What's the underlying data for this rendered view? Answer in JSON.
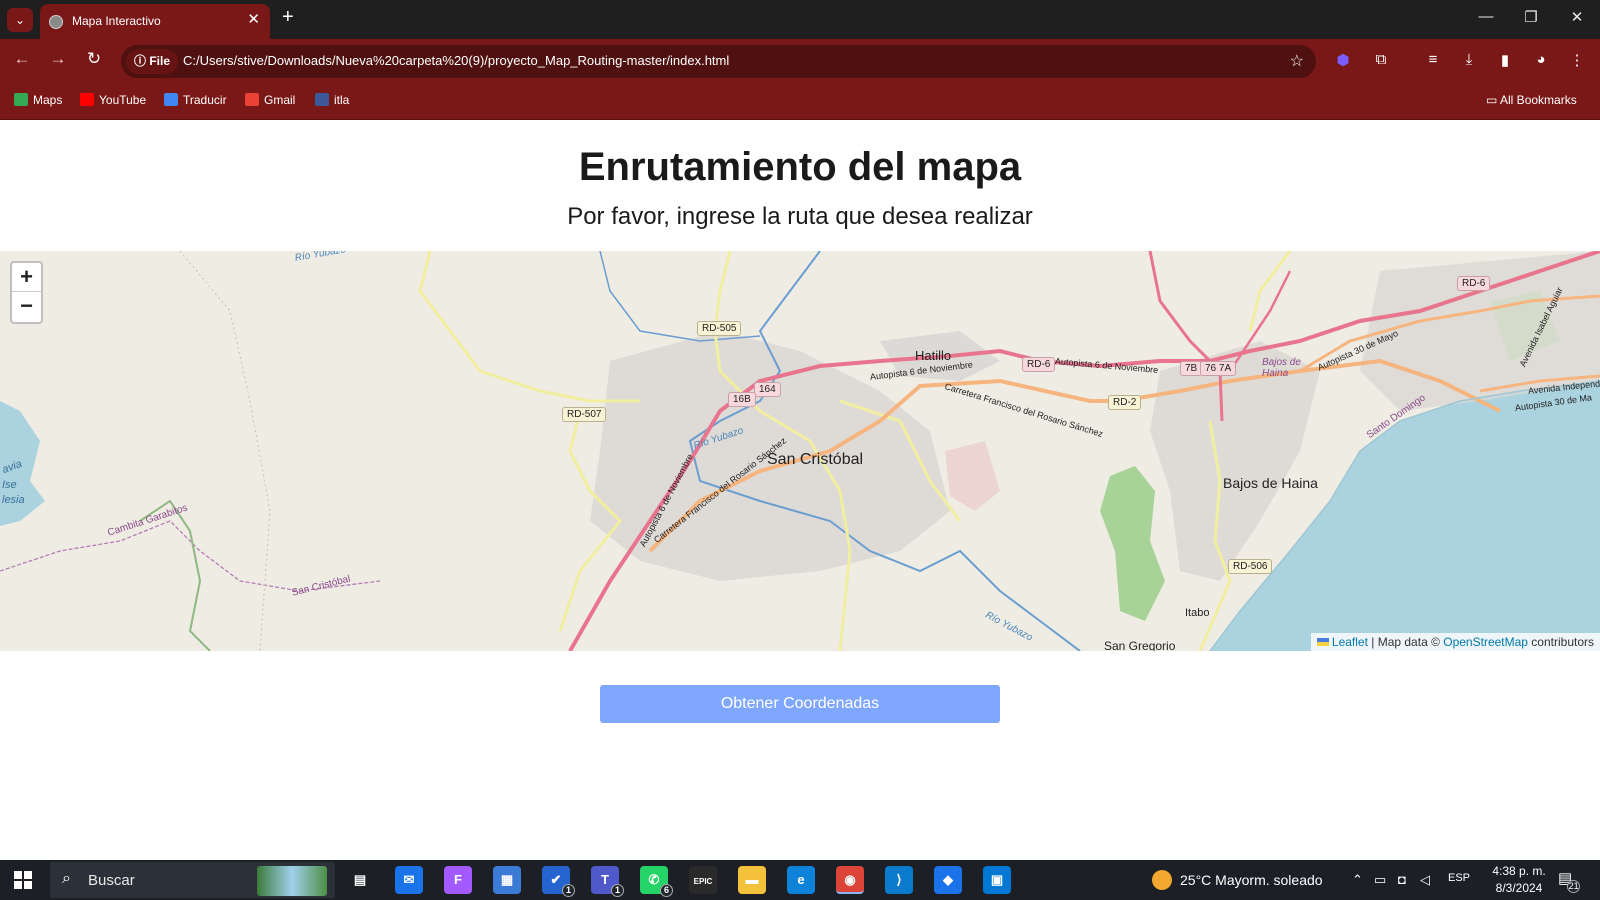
{
  "browser": {
    "tab_title": "Mapa Interactivo",
    "file_chip": "File",
    "url": "C:/Users/stive/Downloads/Nueva%20carpeta%20(9)/proyecto_Map_Routing-master/index.html",
    "bookmarks": [
      {
        "label": "Maps",
        "color": "#34a853"
      },
      {
        "label": "YouTube",
        "color": "#ff0000"
      },
      {
        "label": "Traducir",
        "color": "#4285f4"
      },
      {
        "label": "Gmail",
        "color": "#ea4335"
      },
      {
        "label": "itla",
        "color": "#3b5998"
      }
    ],
    "all_bookmarks": "All Bookmarks"
  },
  "page": {
    "title": "Enrutamiento del mapa",
    "subtitle": "Por favor, ingrese la ruta que desea realizar",
    "button_label": "Obtener Coordenadas"
  },
  "map": {
    "zoom_in": "+",
    "zoom_out": "−",
    "attribution": {
      "leaflet": "Leaflet",
      "separator": " | Map data © ",
      "osm": "OpenStreetMap",
      "suffix": " contributors"
    },
    "places": {
      "hatillo": "Hatillo",
      "san_cristobal": "San Cristóbal",
      "bajos_haina_major": "Bajos de Haina",
      "bajos_haina_minor": "Bajos de Haina",
      "itabo": "Itabo",
      "san_gregorio": "San Gregorio",
      "cambita": "Cambita Garabitos",
      "san_cristobal_small": "San Cristóbal",
      "santo_domingo": "Santo Domingo",
      "lago_a": "Ise",
      "lago_b": "lesia",
      "lago_c": "avia"
    },
    "shields": {
      "rd505": "RD-505",
      "rd507": "RD-507",
      "rd6a": "RD-6",
      "rd6b": "RD-6",
      "rd2": "RD-2",
      "rd506": "RD-506",
      "r164": "164",
      "r16b": "16B",
      "r7b": "7B",
      "r7678": "76 7A"
    },
    "roads": {
      "autopista_6_nov_a": "Autopista 6 de Noviembre",
      "autopista_6_nov_b": "Autopista 6 de Noviembre",
      "autopista_6_nov_c": "Autopista 6 de Noviembre",
      "carretera_fr_a": "Carretera Francisco del Rosario Sánchez",
      "carretera_fr_b": "Carretera Francisco del Rosario Sánchez",
      "autopista_30_mayo": "Autopista 30 de Mayo",
      "autopista_30_ma": "Autopista 30 de Ma",
      "avenida_isabel": "Avenida Isabel Aguiar",
      "avenida_indep": "Avenida Independe"
    },
    "rivers": {
      "rio_yubazo_top": "Río Yubazo",
      "rio_yubazo_mid": "Río Yubazo",
      "rio_yubazo_bottom": "Río Yubazo"
    },
    "colors": {
      "land": "#efece4",
      "water": "#aad3df",
      "motorway": "#e8748e",
      "trunk": "#f6b57f",
      "secondary": "#f2eea0",
      "urban": "#d9d7d3",
      "forest": "#9ecf8f",
      "river": "#6b9ed0"
    }
  },
  "taskbar": {
    "search_placeholder": "Buscar",
    "apps": [
      {
        "name": "task-view",
        "glyph": "▤",
        "color": "transparent",
        "badge": ""
      },
      {
        "name": "mail",
        "glyph": "✉",
        "color": "#1a73e8",
        "badge": ""
      },
      {
        "name": "figma",
        "glyph": "F",
        "color": "#a259ff",
        "badge": ""
      },
      {
        "name": "store",
        "glyph": "▦",
        "color": "#3a7bd5",
        "badge": ""
      },
      {
        "name": "todo",
        "glyph": "✔",
        "color": "#2564cf",
        "badge": "1"
      },
      {
        "name": "teams",
        "glyph": "T",
        "color": "#5059c9",
        "badge": "1"
      },
      {
        "name": "whatsapp",
        "glyph": "✆",
        "color": "#25d366",
        "badge": "6"
      },
      {
        "name": "epic-games",
        "glyph": "EPIC",
        "color": "#2a2a2a",
        "badge": ""
      },
      {
        "name": "file-explorer",
        "glyph": "▬",
        "color": "#f3c13a",
        "badge": ""
      },
      {
        "name": "edge",
        "glyph": "e",
        "color": "#0c83d8",
        "badge": ""
      },
      {
        "name": "chrome",
        "glyph": "◉",
        "color": "#db4437",
        "badge": ""
      },
      {
        "name": "vscode",
        "glyph": "⟩",
        "color": "#0a7acc",
        "badge": ""
      },
      {
        "name": "copilot",
        "glyph": "◆",
        "color": "#1a73e8",
        "badge": ""
      },
      {
        "name": "remote-desktop",
        "glyph": "▣",
        "color": "#0078d4",
        "badge": ""
      }
    ],
    "weather": "25°C  Mayorm. soleado",
    "lang": "ESP",
    "time": "4:38 p. m.",
    "date": "8/3/2024",
    "notifications": "21"
  }
}
